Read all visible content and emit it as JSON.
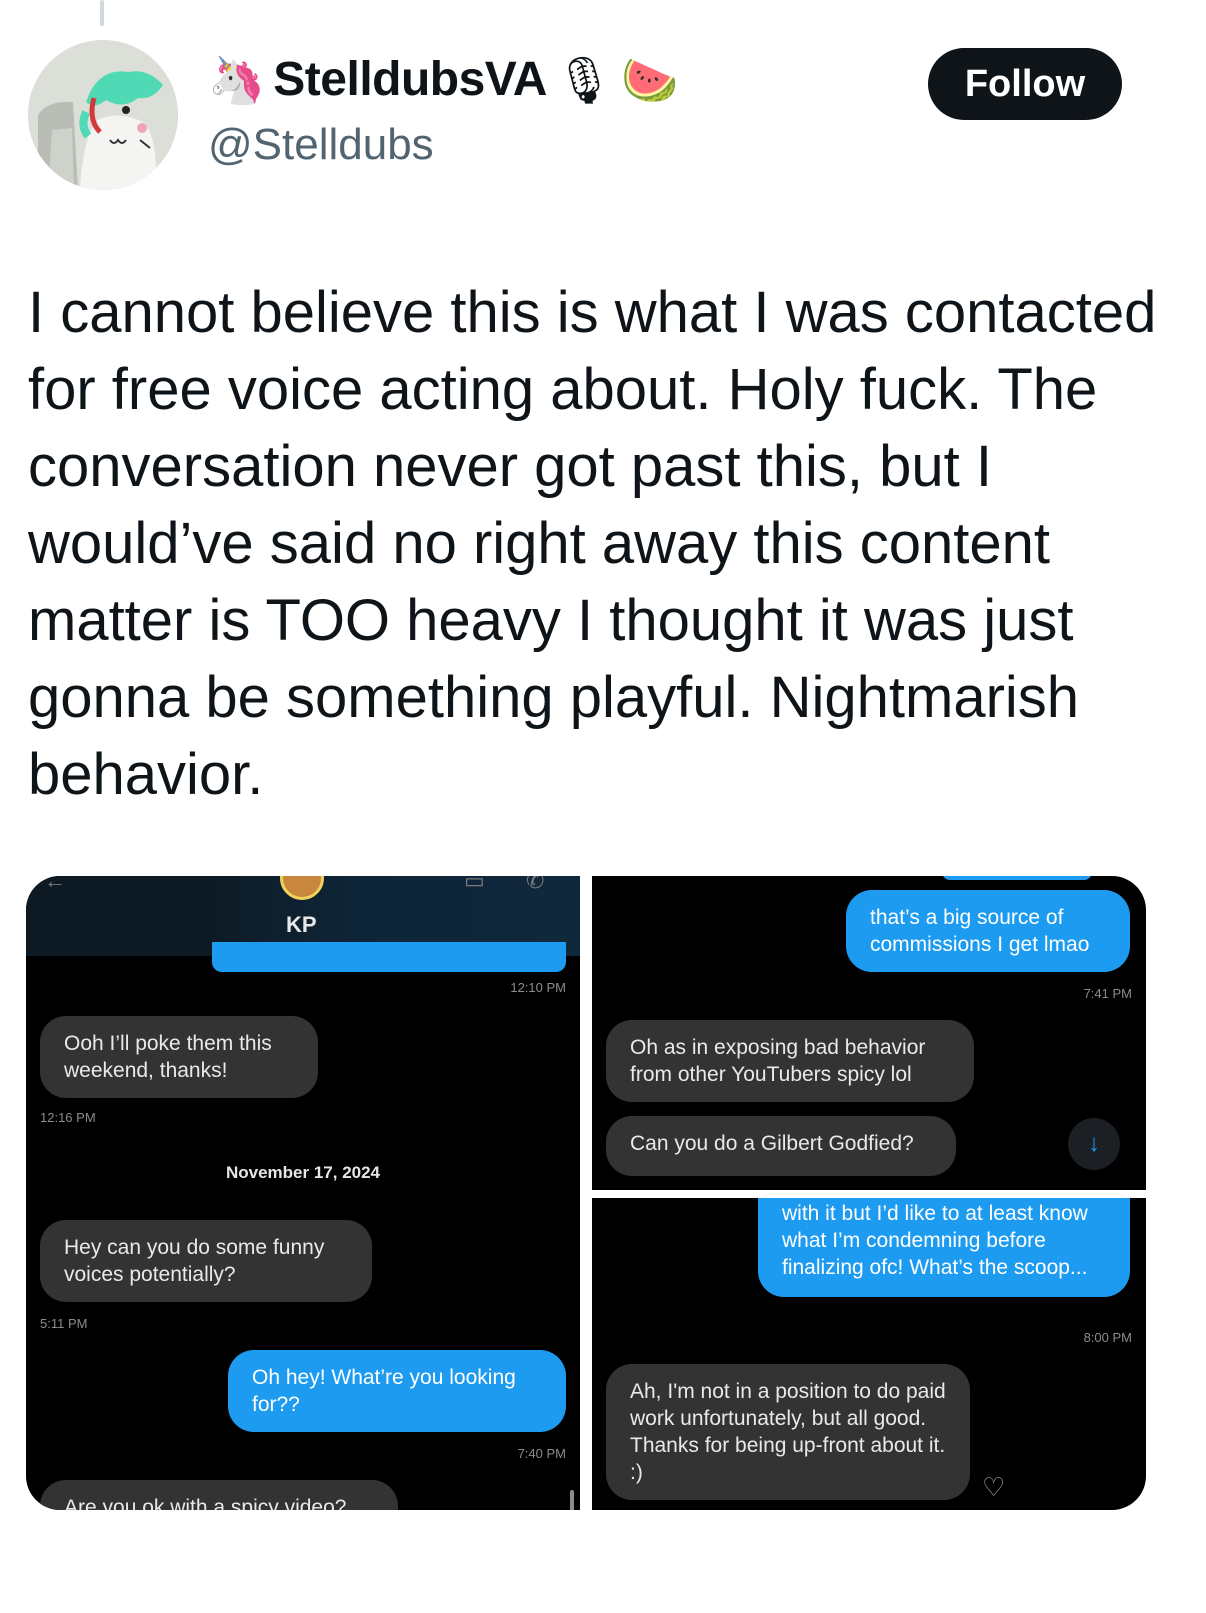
{
  "tweet": {
    "author": {
      "display_name": "StelldubsVA",
      "handle": "@Stelldubs",
      "name_emojis": [
        "🦄",
        "🎙",
        "🍉"
      ]
    },
    "follow_label": "Follow",
    "text": "I cannot believe this is what I was contacted for free voice acting about. Holy fuck. The conversation never got past this, but I would’ve said no right away this content matter is TOO heavy I thought it was just gonna be something playful. Nightmarish behavior."
  },
  "media": {
    "left": {
      "contact_name": "KP",
      "messages": [
        {
          "id": "m0_time",
          "time": "12:10 PM"
        },
        {
          "id": "m1",
          "dir": "in",
          "text": "Ooh I’ll poke them this weekend, thanks!",
          "time": "12:16 PM"
        },
        {
          "id": "date",
          "text": "November 17, 2024"
        },
        {
          "id": "m2",
          "dir": "in",
          "text": "Hey can you do some funny voices potentially?",
          "time": "5:11 PM"
        },
        {
          "id": "m3",
          "dir": "out",
          "text": "Oh hey! What’re you looking for??",
          "time": "7:40 PM"
        },
        {
          "id": "m4",
          "dir": "in",
          "text": "Are you ok with a spicy video?"
        }
      ]
    },
    "top_right": {
      "messages": [
        {
          "dir": "out",
          "text": "that’s a big source of commissions I get lmao",
          "time": "7:41 PM"
        },
        {
          "dir": "in",
          "text": "Oh as in exposing bad behavior from other YouTubers spicy lol"
        },
        {
          "dir": "in",
          "text": "Can you do a Gilbert Godfied?"
        }
      ],
      "scroll_down_icon": "arrow-down-icon"
    },
    "bottom_right": {
      "messages": [
        {
          "dir": "out",
          "text": "with it but I’d like to at least know what I’m condemning before finalizing ofc! What’s the scoop...",
          "time": "8:00 PM"
        },
        {
          "dir": "in",
          "text": "Ah, I'm not in a position to do paid work unfortunately, but all good. Thanks for being up-front about it. :)"
        }
      ],
      "reaction_icon": "heart-plus-icon"
    }
  },
  "colors": {
    "follow_bg": "#0f1419",
    "outgoing_bubble": "#1d9bf0",
    "incoming_bubble": "#333333",
    "handle_gray": "#536471"
  }
}
